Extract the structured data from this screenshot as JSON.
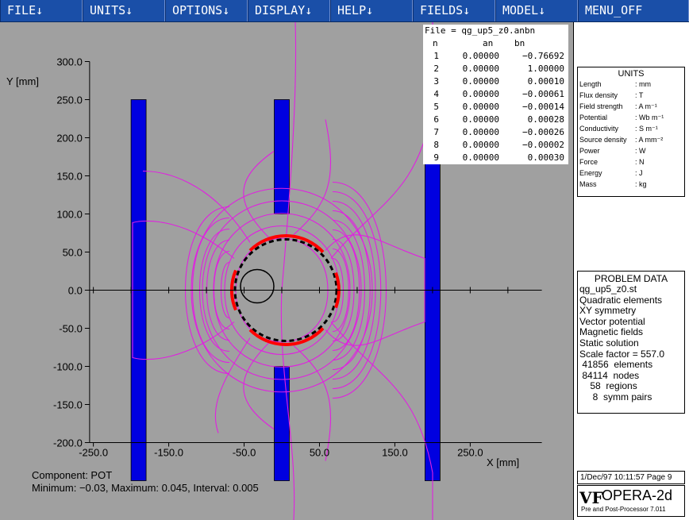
{
  "menu": [
    {
      "label": "FILE↓",
      "name": "menu-file"
    },
    {
      "label": "UNITS↓",
      "name": "menu-units"
    },
    {
      "label": "OPTIONS↓",
      "name": "menu-options"
    },
    {
      "label": "DISPLAY↓",
      "name": "menu-display"
    },
    {
      "label": "HELP↓",
      "name": "menu-help"
    },
    {
      "label": "FIELDS↓",
      "name": "menu-fields"
    },
    {
      "label": "MODEL↓",
      "name": "menu-model"
    },
    {
      "label": "MENU_OFF",
      "name": "menu-off"
    }
  ],
  "colors": {
    "plot_bg": "#a0a0a0",
    "contour": "#e020e0",
    "steel": "#0000e0",
    "coil": "#ff0000",
    "menu": "#1a4fa8"
  },
  "plot": {
    "ylabel": "Y [mm]",
    "xlabel": "X [mm]",
    "x_ticks": [
      "-250.0",
      "-150.0",
      "-50.0",
      "50.0",
      "150.0",
      "250.0"
    ],
    "y_ticks": [
      "300.0",
      "250.0",
      "200.0",
      "150.0",
      "100.0",
      "50.0",
      "0.0",
      "-50.0",
      "-100.0",
      "-150.0",
      "-200.0"
    ],
    "component": "Component: POT",
    "minmax": "Minimum: −0.03,  Maximum: 0.045,  Interval: 0.005"
  },
  "harmonics": {
    "file": "File = qg_up5_z0.anbn",
    "headers": [
      "n",
      "an",
      "bn"
    ],
    "rows": [
      [
        "1",
        "0.00000",
        "−0.76692"
      ],
      [
        "2",
        "0.00000",
        "1.00000"
      ],
      [
        "3",
        "0.00000",
        "0.00010"
      ],
      [
        "4",
        "0.00000",
        "−0.00061"
      ],
      [
        "5",
        "0.00000",
        "−0.00014"
      ],
      [
        "6",
        "0.00000",
        "0.00028"
      ],
      [
        "7",
        "0.00000",
        "−0.00026"
      ],
      [
        "8",
        "0.00000",
        "−0.00002"
      ],
      [
        "9",
        "0.00000",
        "0.00030"
      ]
    ]
  },
  "units": {
    "title": "UNITS",
    "rows": [
      {
        "k": "Length",
        "v": ": mm"
      },
      {
        "k": "Flux density",
        "v": ": T"
      },
      {
        "k": "Field strength",
        "v": ": A m⁻¹"
      },
      {
        "k": "Potential",
        "v": ": Wb m⁻¹"
      },
      {
        "k": "Conductivity",
        "v": ": S m⁻¹"
      },
      {
        "k": "Source density",
        "v": ": A mm⁻²"
      },
      {
        "k": "Power",
        "v": ": W"
      },
      {
        "k": "Force",
        "v": ": N"
      },
      {
        "k": "Energy",
        "v": ": J"
      },
      {
        "k": "Mass",
        "v": ": kg"
      }
    ]
  },
  "problem": {
    "title": "PROBLEM DATA",
    "lines": [
      "qg_up5_z0.st",
      "Quadratic elements",
      "XY symmetry",
      "Vector potential",
      "Magnetic fields",
      "Static solution",
      "Scale factor = 557.0",
      " 41856  elements",
      " 84114  nodes",
      "    58  regions",
      "     8  symm pairs"
    ]
  },
  "footer": {
    "date": "1/Dec/97 10:11:57 Page 9",
    "logo_mark": "VF",
    "logo": "OPERA-2d",
    "logo_sub": "Pre and Post-Processor 7.011"
  }
}
